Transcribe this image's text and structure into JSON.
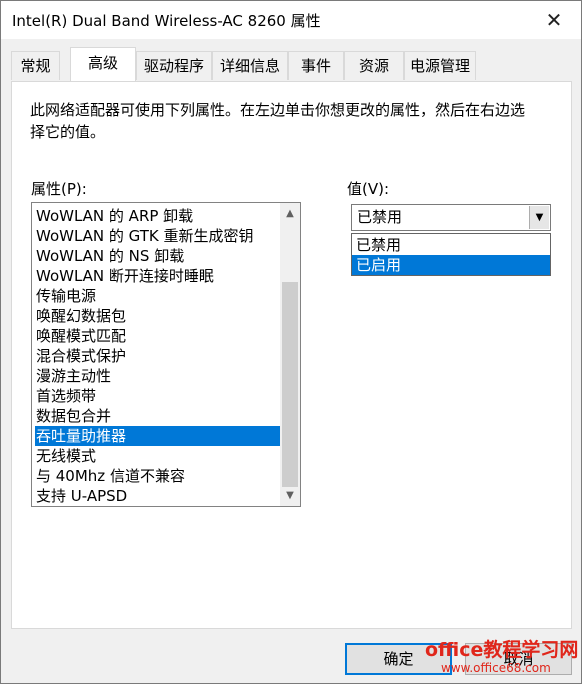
{
  "window": {
    "title": "Intel(R) Dual Band Wireless-AC 8260 属性",
    "close_glyph": "✕"
  },
  "tabs": [
    {
      "label": "常规"
    },
    {
      "label": "高级",
      "active": true
    },
    {
      "label": "驱动程序"
    },
    {
      "label": "详细信息"
    },
    {
      "label": "事件"
    },
    {
      "label": "资源"
    },
    {
      "label": "电源管理"
    }
  ],
  "description": "此网络适配器可使用下列属性。在左边单击你想更改的属性，然后在右边选择它的值。",
  "property": {
    "label": "属性(P):",
    "items": [
      "WoWLAN 的 ARP 卸载",
      "WoWLAN 的 GTK 重新生成密钥",
      "WoWLAN 的 NS 卸载",
      "WoWLAN 断开连接时睡眠",
      "传输电源",
      "唤醒幻数据包",
      "唤醒模式匹配",
      "混合模式保护",
      "漫游主动性",
      "首选频带",
      "数据包合并",
      "吞吐量助推器",
      "无线模式",
      "与 40Mhz 信道不兼容",
      "支持 U-APSD"
    ],
    "selected": "吞吐量助推器",
    "scroll_up_glyph": "▲",
    "scroll_down_glyph": "▼"
  },
  "value": {
    "label": "值(V):",
    "current": "已禁用",
    "dropdown_glyph": "▼",
    "options": [
      "已禁用",
      "已启用"
    ],
    "highlighted": "已启用"
  },
  "buttons": {
    "ok": "确定",
    "cancel": "取消"
  },
  "watermark": {
    "brand": "office教程学习网",
    "url": "www.office68.com"
  },
  "colors": {
    "selection": "#0078d7",
    "watermark": "#e0261b"
  }
}
